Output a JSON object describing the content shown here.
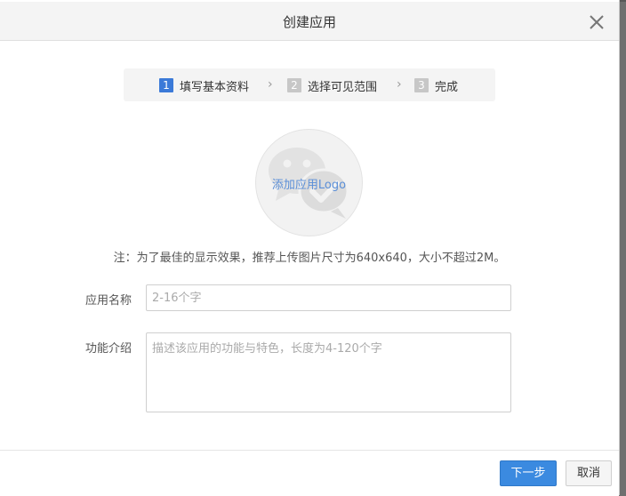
{
  "dialog": {
    "title": "创建应用",
    "close_icon": "close-icon"
  },
  "steps": [
    {
      "num": "1",
      "label": "填写基本资料",
      "state": "active"
    },
    {
      "num": "2",
      "label": "选择可见范围",
      "state": "inactive"
    },
    {
      "num": "3",
      "label": "完成",
      "state": "inactive"
    }
  ],
  "logo_upload": {
    "label": "添加应用Logo",
    "icon": "chat-bubbles-icon"
  },
  "note": "注：为了最佳的显示效果，推荐上传图片尺寸为640x640，大小不超过2M。",
  "form": {
    "name_label": "应用名称",
    "name_placeholder": "2-16个字",
    "name_value": "",
    "desc_label": "功能介绍",
    "desc_placeholder": "描述该应用的功能与特色，长度为4-120个字",
    "desc_value": ""
  },
  "footer": {
    "next_label": "下一步",
    "cancel_label": "取消"
  },
  "colors": {
    "accent": "#3b8ae0",
    "step_active": "#3b7ad8",
    "step_inactive": "#c7c7c7",
    "link": "#5b8fd8"
  }
}
